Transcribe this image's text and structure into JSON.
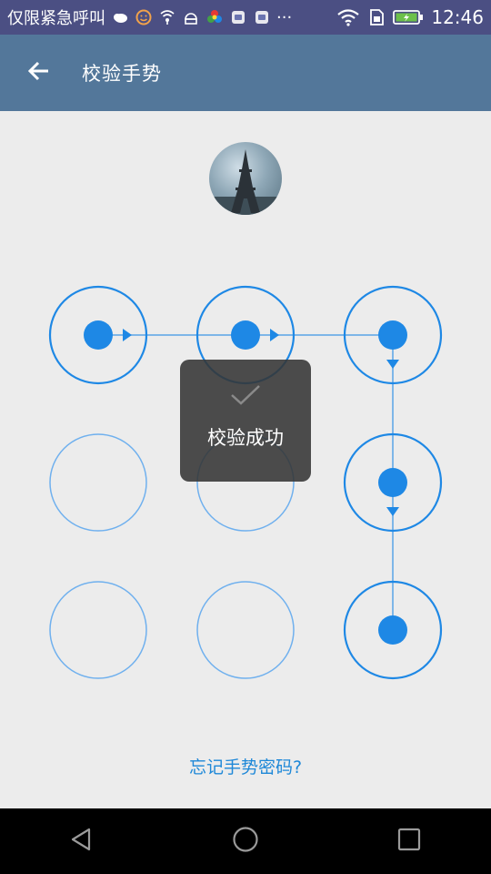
{
  "status_bar": {
    "left_text": "仅限紧急呼叫",
    "time": "12:46",
    "icons": [
      "cloud-icon",
      "emoji-icon",
      "hotspot-icon",
      "android-icon",
      "color-wheel-icon",
      "app-icon",
      "app-icon",
      "more-icon",
      "wifi-icon",
      "sim-icon",
      "battery-charging-icon"
    ],
    "more": "···"
  },
  "app_bar": {
    "title": "校验手势",
    "back_icon": "arrow-left-icon"
  },
  "pattern": {
    "accent_color": "#1e88e5",
    "selected_dots": [
      0,
      1,
      2,
      5,
      8
    ],
    "path_order": [
      0,
      1,
      2,
      5,
      8
    ]
  },
  "toast": {
    "message": "校验成功",
    "icon": "check-icon"
  },
  "footer": {
    "forgot_link": "忘记手势密码?"
  },
  "nav_bar": {
    "back": "triangle-back-icon",
    "home": "circle-home-icon",
    "recents": "square-recents-icon"
  }
}
